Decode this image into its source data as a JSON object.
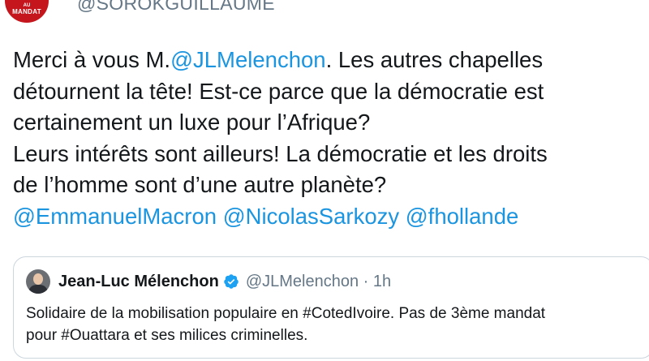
{
  "author": {
    "avatar_text_top": "AU",
    "avatar_text_bottom": "MANDAT",
    "handle": "@SOROKGUILLAUME"
  },
  "tweet": {
    "line1_prefix": "Merci à vous M.",
    "line1_mention": "@JLMelenchon",
    "line1_suffix": ". Les autres chapelles",
    "line2": "détournent la tête! Est-ce parce que la démocratie est",
    "line3": "certainement un luxe pour l’Afrique?",
    "line4": "Leurs intérêts sont ailleurs! La démocratie et les droits",
    "line5": "de l’homme sont d’une autre planète?",
    "mention1": "@EmmanuelMacron",
    "mention2": "@NicolasSarkozy",
    "mention3": "@fhollande"
  },
  "quoted_tweet": {
    "name": "Jean-Luc Mélenchon",
    "meta": "@JLMelenchon · 1h",
    "line1": "Solidaire de la mobilisation populaire en #CotedIvoire. Pas de 3ème mandat",
    "line2": "pour #Ouattara et ses milices criminelles."
  },
  "colors": {
    "link": "#1b95e0",
    "text": "#14171a",
    "muted": "#657786",
    "verified": "#1da1f2",
    "avatar_bg": "#c4161c"
  }
}
